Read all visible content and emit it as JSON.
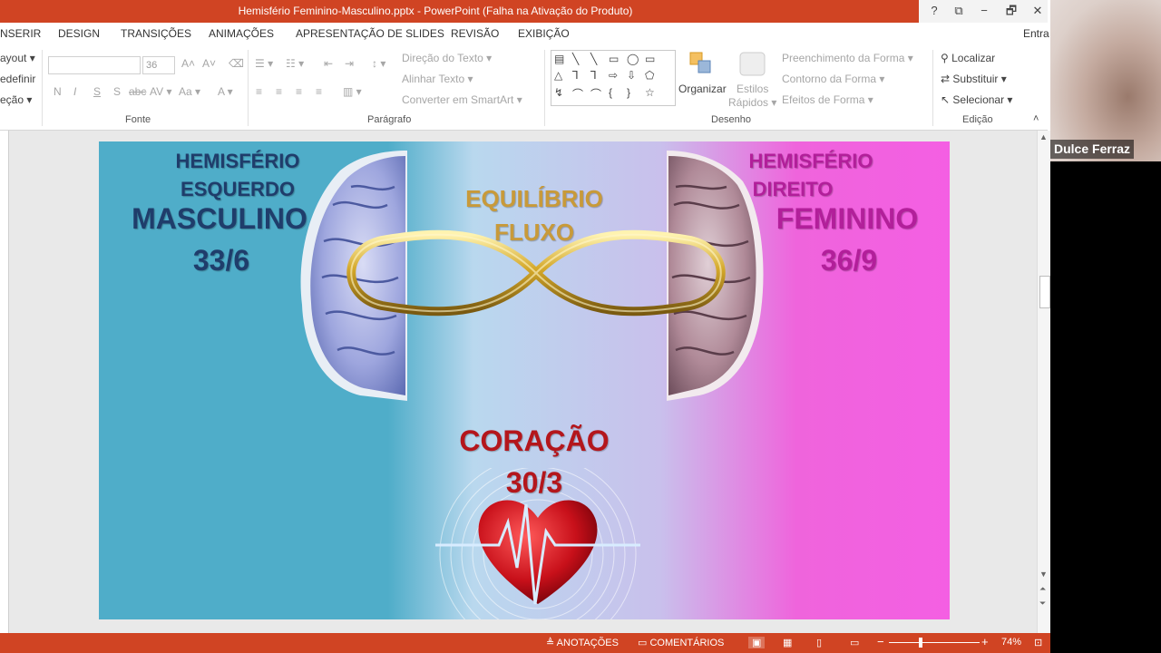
{
  "window": {
    "title": "Hemisfério Feminino-Masculino.pptx - PowerPoint (Falha na Ativação do Produto)",
    "help": "?",
    "restore_ribbon": "⧉",
    "minimize": "−",
    "maximize": "🗗",
    "close": "✕"
  },
  "tabs": [
    {
      "label": "NSERIR"
    },
    {
      "label": "DESIGN"
    },
    {
      "label": "TRANSIÇÕES"
    },
    {
      "label": "ANIMAÇÕES"
    },
    {
      "label": "APRESENTAÇÃO DE SLIDES"
    },
    {
      "label": "REVISÃO"
    },
    {
      "label": "EXIBIÇÃO"
    }
  ],
  "signin": "Entra",
  "ribbon": {
    "slides": {
      "layout": "ayout ▾",
      "reset": "edefinir",
      "section": "eção ▾"
    },
    "font": {
      "size": "36",
      "group": "Fonte",
      "grow": "A˄",
      "shrink": "A˅",
      "clear": "⌫",
      "bold": "N",
      "italic": "I",
      "underline": "S",
      "strike": "S",
      "shadow": "abc",
      "spacing": "AV ▾",
      "case": "Aa ▾",
      "color": "A ▾"
    },
    "paragraph": {
      "group": "Parágrafo",
      "direction": "Direção do Texto ▾",
      "align": "Alinhar Texto ▾",
      "smartart": "Converter em SmartArt ▾",
      "bullets": "☰ ▾",
      "numbering": "☷ ▾",
      "decrease": "⇤",
      "increase": "⇥",
      "linespacing": "↕ ▾",
      "left": "≡",
      "center": "≡",
      "right": "≡",
      "justify": "≡",
      "columns": "▥ ▾"
    },
    "drawing": {
      "group": "Desenho",
      "arrange": "Organizar",
      "styles1": "Estilos",
      "styles2": "Rápidos ▾",
      "fill": "Preenchimento da Forma ▾",
      "outline": "Contorno da Forma ▾",
      "effects": "Efeitos de Forma ▾",
      "shapes_row1": [
        "▤",
        "╲",
        "╲",
        "▭",
        "◯",
        "▭"
      ],
      "shapes_row2": [
        "△",
        "⅂",
        "⅂",
        "⇨",
        "⇩",
        "⬠"
      ],
      "shapes_row3": [
        "↯",
        "⌒",
        "⌒",
        "{",
        "}",
        "☆"
      ]
    },
    "editing": {
      "group": "Edição",
      "find": "Localizar",
      "replace": "Substituir ▾",
      "select": "Selecionar ▾"
    }
  },
  "slide": {
    "left_title1": "HEMISFÉRIO",
    "left_title2": "ESQUERDO",
    "left_big": "MASCULINO",
    "left_num": "33/6",
    "center_title1": "EQUILÍBRIO",
    "center_title2": "FLUXO",
    "right_title1": "HEMISFÉRIO",
    "right_title2": "DIREITO",
    "right_big": "FEMININO",
    "right_num": "36/9",
    "heart_title": "CORAÇÃO",
    "heart_num": "30/3"
  },
  "status": {
    "notes": "ANOTAÇÕES",
    "comments": "COMENTÁRIOS",
    "zoom_out": "−",
    "zoom_in": "+",
    "zoom": "74%"
  },
  "webcam": {
    "name": "Dulce Ferraz"
  },
  "colors": {
    "accent": "#d04423",
    "left_text": "#1f3d6b",
    "center_text": "#c89a3a",
    "right_text": "#b21f9a",
    "heart_text": "#b4161c"
  }
}
